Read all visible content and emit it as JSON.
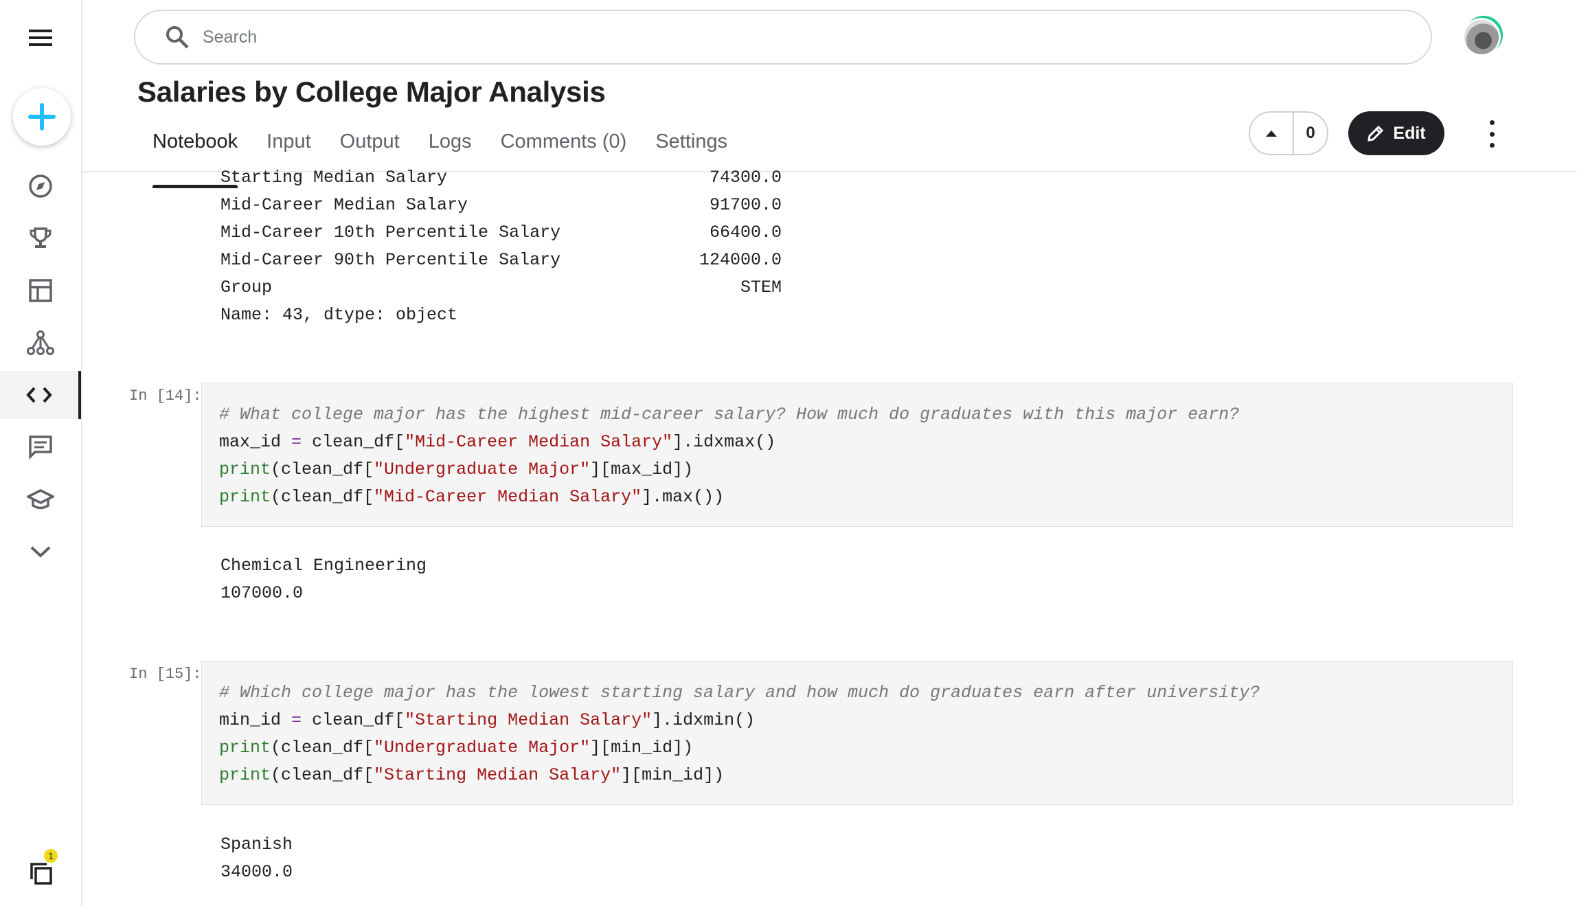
{
  "sidebar": {
    "items": [
      "menu",
      "create",
      "explore",
      "competitions",
      "datasets",
      "models",
      "code",
      "discussions",
      "learn",
      "more"
    ],
    "notification_count": "1"
  },
  "search": {
    "placeholder": "Search"
  },
  "notebook": {
    "title": "Salaries by College Major Analysis",
    "tabs": [
      "Notebook",
      "Input",
      "Output",
      "Logs",
      "Comments (0)",
      "Settings"
    ],
    "active_tab": "Notebook",
    "vote_count": "0",
    "edit_label": "Edit"
  },
  "top_output": {
    "rows": [
      {
        "label": "Starting Median Salary",
        "value": "74300.0"
      },
      {
        "label": "Mid-Career Median Salary",
        "value": "91700.0"
      },
      {
        "label": "Mid-Career 10th Percentile Salary",
        "value": "66400.0"
      },
      {
        "label": "Mid-Career 90th Percentile Salary",
        "value": "124000.0"
      },
      {
        "label": "Group",
        "value": "STEM"
      }
    ],
    "footer": "Name: 43, dtype: object"
  },
  "cells": [
    {
      "prompt": "In [14]:",
      "comment": "# What college major has the highest mid-career salary? How much do graduates with this major earn?",
      "line1_var": "max_id",
      "line1_call": "clean_df[",
      "line1_str": "\"Mid-Career Median Salary\"",
      "line1_end": "].idxmax()",
      "line2_fn": "print",
      "line2_a": "(clean_df[",
      "line2_str": "\"Undergraduate Major\"",
      "line2_end": "][max_id])",
      "line3_fn": "print",
      "line3_a": "(clean_df[",
      "line3_str": "\"Mid-Career Median Salary\"",
      "line3_end": "].max())",
      "output": [
        "Chemical Engineering",
        "107000.0"
      ]
    },
    {
      "prompt": "In [15]:",
      "comment": "# Which college major has the lowest starting salary and how much do graduates earn after university?",
      "line1_var": "min_id",
      "line1_call": "clean_df[",
      "line1_str": "\"Starting Median Salary\"",
      "line1_end": "].idxmin()",
      "line2_fn": "print",
      "line2_a": "(clean_df[",
      "line2_str": "\"Undergraduate Major\"",
      "line2_end": "][min_id])",
      "line3_fn": "print",
      "line3_a": "(clean_df[",
      "line3_str": "\"Starting Median Salary\"",
      "line3_end": "][min_id])",
      "output": [
        "Spanish",
        "34000.0"
      ]
    }
  ]
}
